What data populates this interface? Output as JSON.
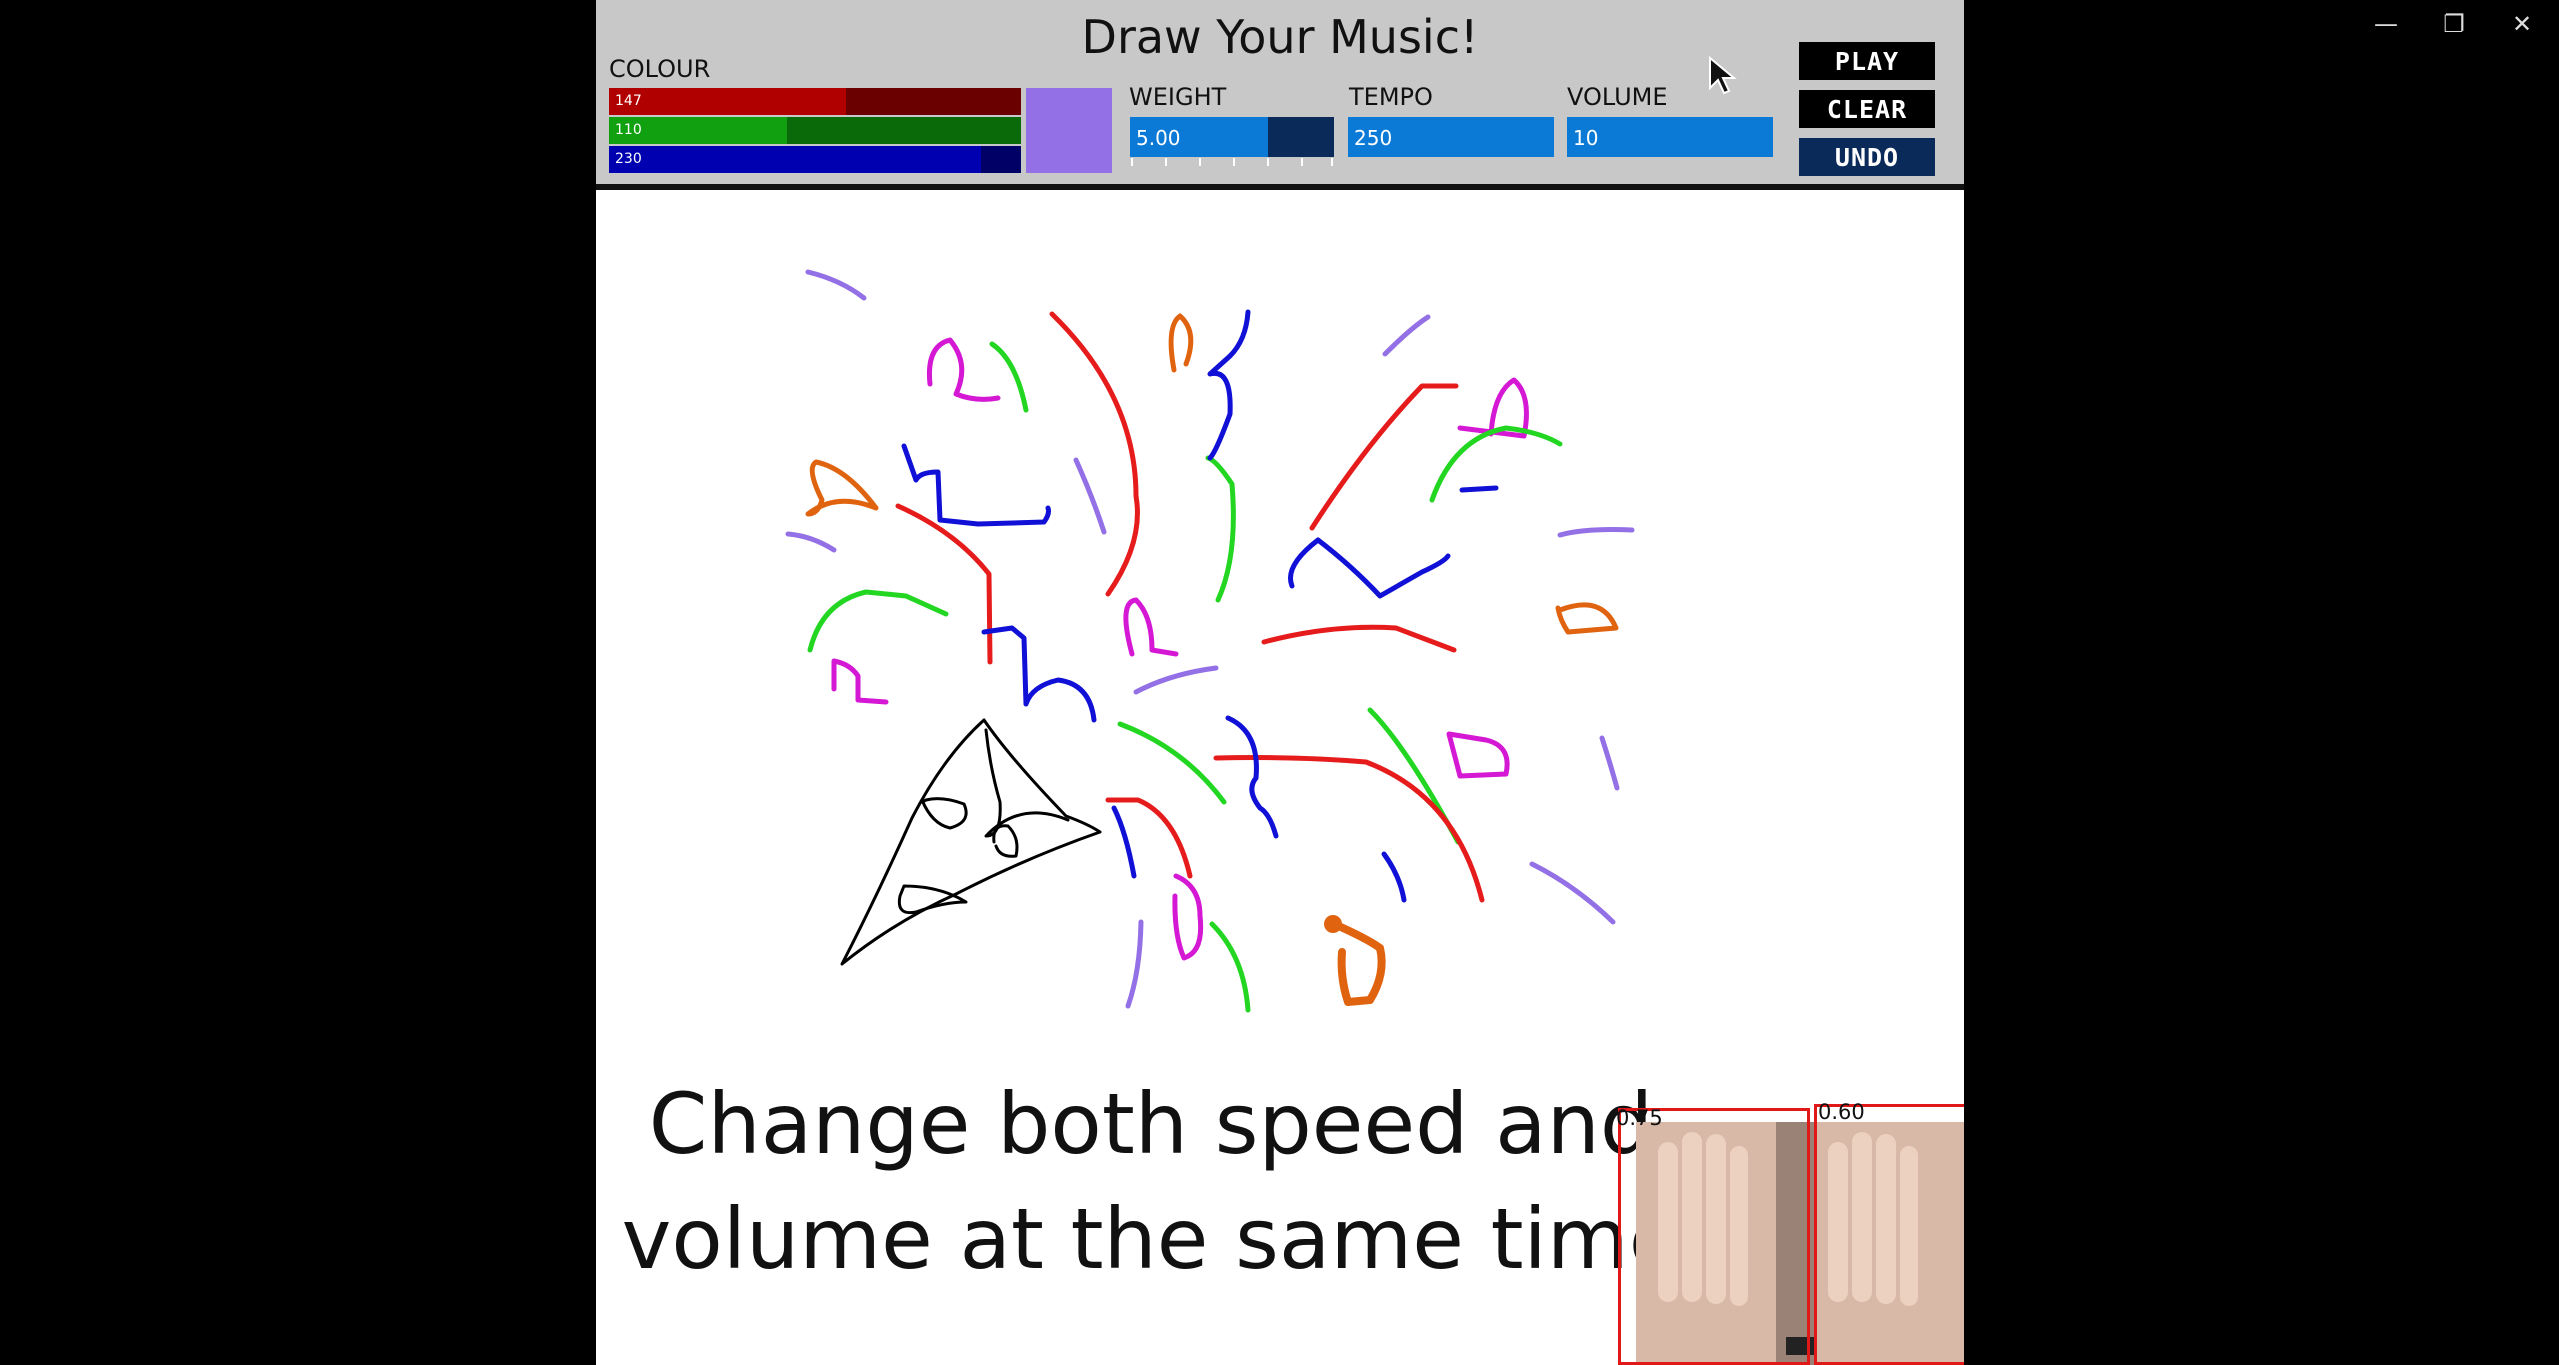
{
  "app": {
    "title": "Draw Your Music!",
    "colour_label": "COLOUR",
    "red": {
      "value": "147",
      "fraction": 0.576
    },
    "green": {
      "value": "110",
      "fraction": 0.431
    },
    "blue": {
      "value": "230",
      "fraction": 0.902
    },
    "swatch_color": "#9370e6",
    "weight": {
      "label": "WEIGHT",
      "value": "5.00",
      "fraction": 0.675
    },
    "tempo": {
      "label": "TEMPO",
      "value": "250"
    },
    "volume": {
      "label": "VOLUME",
      "value": "10"
    },
    "buttons": {
      "play": "PLAY",
      "clear": "CLEAR",
      "undo": "UNDO"
    },
    "caption": {
      "line1": "Change both speed and",
      "line2": "volume at the same time"
    },
    "detections": {
      "left_score": "0.75",
      "right_score": "0.60"
    }
  },
  "colors": {
    "red": "#e61c1c",
    "green": "#22d622",
    "blue": "#1010d6",
    "purple": "#9370e6",
    "magenta": "#d418d4",
    "orange": "#e06410",
    "black": "#000000",
    "accent": "#0a7ad6"
  },
  "window_controls": {
    "minimize": "minimize-icon",
    "restore": "restore-icon",
    "close": "close-icon"
  }
}
